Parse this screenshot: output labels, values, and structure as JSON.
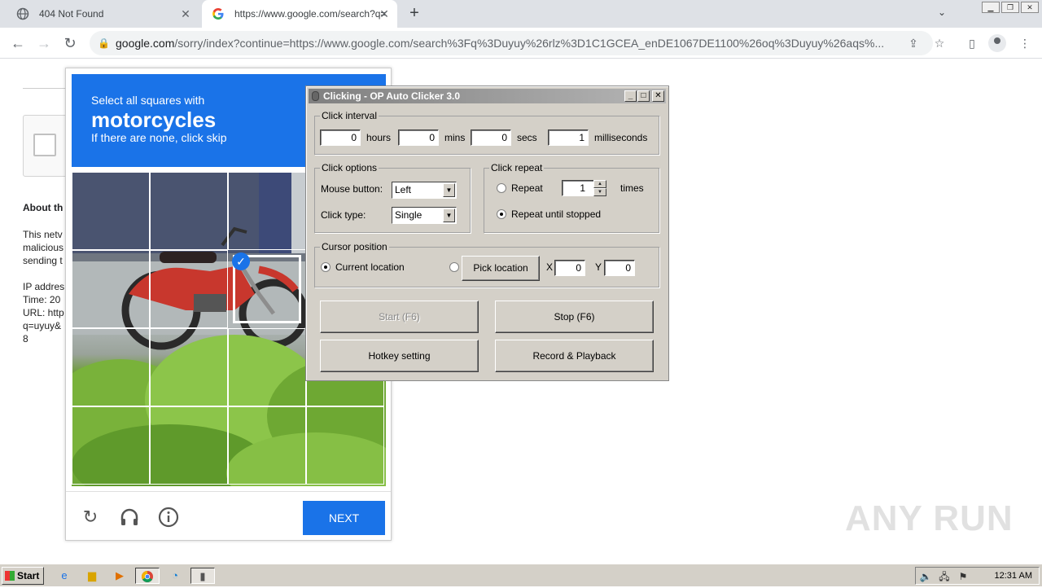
{
  "browser": {
    "tabs": [
      {
        "title": "404 Not Found",
        "icon": "globe-icon"
      },
      {
        "title": "https://www.google.com/search?q=",
        "icon": "google-icon"
      }
    ],
    "url_host": "google.com",
    "url_rest": "/sorry/index?continue=https://www.google.com/search%3Fq%3Duyuy%26rlz%3D1C1GCEA_enDE1067DE1100%26oq%3Duyuy%26aqs%..."
  },
  "page": {
    "about": "About th",
    "lines": [
      "This netv",
      "malicious",
      "sending t",
      "IP addres",
      "Time: 20",
      "URL: http",
      "q=uyuy&",
      "8"
    ]
  },
  "captcha": {
    "line1": "Select all squares with",
    "line2": "motorcycles",
    "line3": "If there are none, click skip",
    "next_label": "NEXT",
    "selected_cells": [
      [
        2,
        1
      ]
    ]
  },
  "clicker": {
    "title": "Clicking - OP Auto Clicker 3.0",
    "interval": {
      "group": "Click interval",
      "hours": "0",
      "hours_label": "hours",
      "mins": "0",
      "mins_label": "mins",
      "secs": "0",
      "secs_label": "secs",
      "ms": "1",
      "ms_label": "milliseconds"
    },
    "options": {
      "group": "Click options",
      "mouse_label": "Mouse button:",
      "mouse_value": "Left",
      "type_label": "Click type:",
      "type_value": "Single"
    },
    "repeat": {
      "group": "Click repeat",
      "repeat_label": "Repeat",
      "repeat_count": "1",
      "times_label": "times",
      "until_label": "Repeat until stopped"
    },
    "cursor": {
      "group": "Cursor position",
      "current_label": "Current location",
      "pick_label": "Pick location",
      "x_label": "X",
      "x": "0",
      "y_label": "Y",
      "y": "0"
    },
    "buttons": {
      "start": "Start (F6)",
      "stop": "Stop (F6)",
      "hotkey": "Hotkey setting",
      "record": "Record & Playback"
    }
  },
  "watermark": "ANY RUN",
  "taskbar": {
    "start_label": "Start",
    "clock": "12:31 AM"
  }
}
